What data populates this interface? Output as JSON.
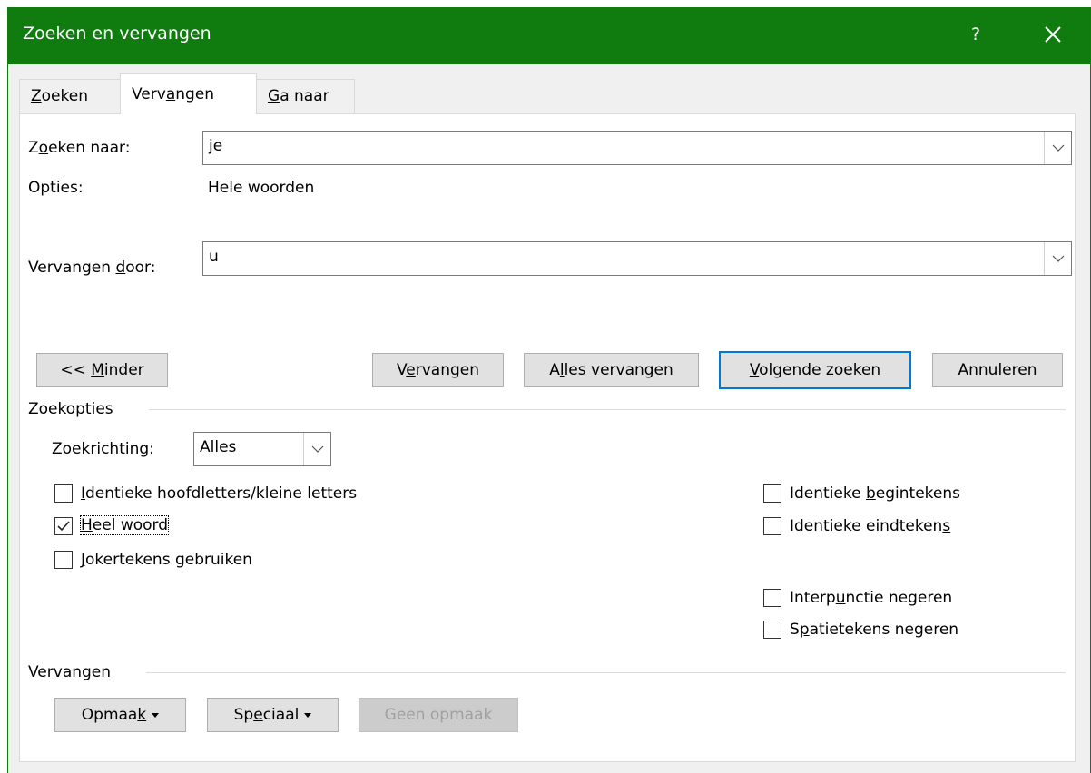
{
  "window": {
    "title": "Zoeken en vervangen",
    "help": "?",
    "close_icon": "close-icon"
  },
  "tabs": [
    {
      "pre": "",
      "ul": "Z",
      "post": "oeken"
    },
    {
      "pre": "Verv",
      "ul": "a",
      "post": "ngen"
    },
    {
      "pre": "",
      "ul": "G",
      "post": "a naar"
    }
  ],
  "find": {
    "label_pre": "Z",
    "label_ul": "o",
    "label_post": "eken naar:",
    "value": "je"
  },
  "options": {
    "label": "Opties:",
    "value": "Hele woorden"
  },
  "replace": {
    "label_pre": "Vervangen ",
    "label_ul": "d",
    "label_post": "oor:",
    "value": "u"
  },
  "buttons": {
    "minder_pre": "<< ",
    "minder_ul": "M",
    "minder_post": "inder",
    "vervangen_pre": "V",
    "vervangen_ul": "e",
    "vervangen_post": "rvangen",
    "alles_pre": "A",
    "alles_ul": "l",
    "alles_post": "les vervangen",
    "volgende_pre": "",
    "volgende_ul": "V",
    "volgende_post": "olgende zoeken",
    "annuleren": "Annuleren"
  },
  "zoekopties": {
    "heading": "Zoekopties",
    "richting_pre": "Zoek",
    "richting_ul": "r",
    "richting_post": "ichting:",
    "richting_value": "Alles",
    "left": [
      {
        "checked": false,
        "pre": "",
        "ul": "I",
        "post": "dentieke hoofdletters/kleine letters"
      },
      {
        "checked": true,
        "pre": "",
        "ul": "H",
        "post": "eel woord"
      },
      {
        "checked": false,
        "pre": "",
        "ul": "J",
        "post": "okertekens gebruiken"
      }
    ],
    "right": [
      {
        "checked": false,
        "pre": "Identieke ",
        "ul": "b",
        "post": "egintekens"
      },
      {
        "checked": false,
        "pre": "Identieke eindteken",
        "ul": "s",
        "post": ""
      },
      {
        "checked": false,
        "pre": "Interp",
        "ul": "u",
        "post": "nctie negeren"
      },
      {
        "checked": false,
        "pre": "S",
        "ul": "p",
        "post": "atietekens negeren"
      }
    ]
  },
  "vervangen_section": {
    "heading": "Vervangen",
    "opmaak_pre": "Opmaa",
    "opmaak_ul": "k",
    "opmaak_post": "",
    "speciaal_pre": "Sp",
    "speciaal_ul": "e",
    "speciaal_post": "ciaal",
    "geen_opmaak": "Geen opmaak"
  }
}
